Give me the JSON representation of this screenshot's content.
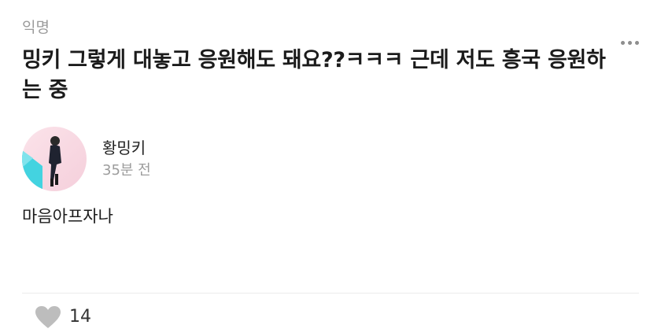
{
  "post": {
    "author": "익명",
    "title": "밍키 그렇게 대놓고 응원해도 돼요??ㅋㅋㅋ 근데 저도 흥국 응원하는 중"
  },
  "comment": {
    "author_name": "황밍키",
    "time": "35분 전",
    "body": "마음아프자나"
  },
  "actions": {
    "like_count": "14",
    "more_icon": "more-horizontal-icon",
    "like_icon": "heart-icon"
  },
  "colors": {
    "meta_gray": "#9b9b9b",
    "heart_gray": "#bdbdbd",
    "avatar_pink": "#f7d3de",
    "avatar_cyan": "#43d3e0"
  }
}
